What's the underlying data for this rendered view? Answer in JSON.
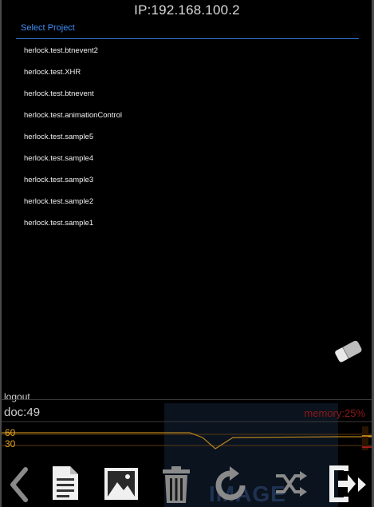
{
  "header": {
    "ip": "IP:192.168.100.2"
  },
  "dialog": {
    "title": "Select Project",
    "projects": [
      "herlock.test.btnevent2",
      "herlock.test.XHR",
      "herlock.test.btnevent",
      "herlock.test.animationControl",
      "herlock.test.sample5",
      "herlock.test.sample4",
      "herlock.test.sample3",
      "herlock.test.sample2",
      "herlock.test.sample1"
    ]
  },
  "hud": {
    "logout": "logout",
    "doc_count": "doc:49",
    "memory": "memory:25%",
    "y_label_high": "60",
    "y_label_low": "30"
  },
  "background": {
    "image_label": "IMAGE"
  },
  "toolbar": {
    "tools": [
      "back-icon",
      "document-icon",
      "image-icon",
      "trash-icon",
      "reload-icon",
      "shuffle-icon",
      "exit-icon",
      "forward-icon"
    ]
  },
  "colors": {
    "accent": "#3e8ef7",
    "graph_line": "#e6a21e",
    "memory": "#8e1818",
    "background": "#000000"
  }
}
